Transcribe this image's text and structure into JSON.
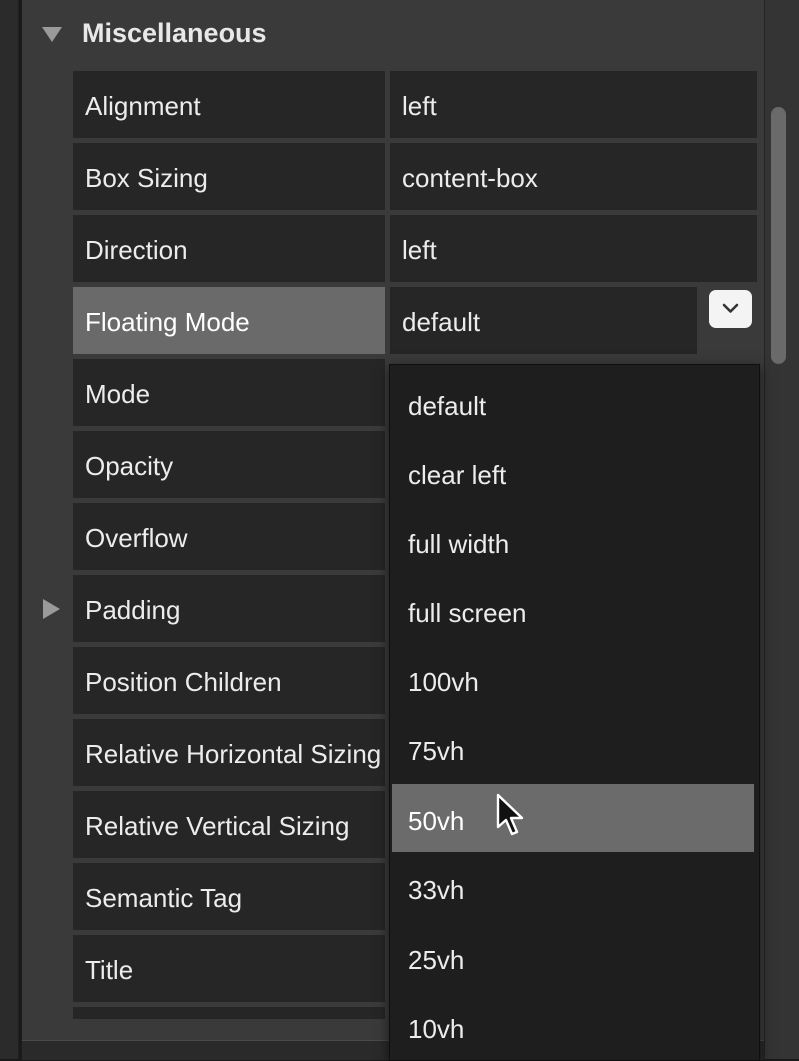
{
  "section": {
    "title": "Miscellaneous"
  },
  "rows": [
    {
      "label": "Alignment",
      "value": "left"
    },
    {
      "label": "Box Sizing",
      "value": "content-box"
    },
    {
      "label": "Direction",
      "value": "left"
    },
    {
      "label": "Floating Mode",
      "value": "default"
    },
    {
      "label": "Mode",
      "value": ""
    },
    {
      "label": "Opacity",
      "value": ""
    },
    {
      "label": "Overflow",
      "value": ""
    },
    {
      "label": "Padding",
      "value": ""
    },
    {
      "label": "Position Children",
      "value": ""
    },
    {
      "label": "Relative Horizontal Sizing",
      "value": ""
    },
    {
      "label": "Relative Vertical Sizing",
      "value": ""
    },
    {
      "label": "Semantic Tag",
      "value": ""
    },
    {
      "label": "Title",
      "value": ""
    }
  ],
  "dropdown": {
    "selected": "default",
    "highlighted": "50vh",
    "options": [
      "default",
      "clear left",
      "full width",
      "full screen",
      "100vh",
      "75vh",
      "50vh",
      "33vh",
      "25vh",
      "10vh"
    ]
  },
  "icons": {
    "collapse": "triangle-down-icon",
    "expand": "triangle-right-icon",
    "dropdown": "chevron-down-icon",
    "cursor": "mouse-pointer-icon"
  },
  "colors": {
    "panel": "#3a3a3a",
    "cell": "#262626",
    "active": "#6a6a6a",
    "menu": "#1e1e1e"
  }
}
